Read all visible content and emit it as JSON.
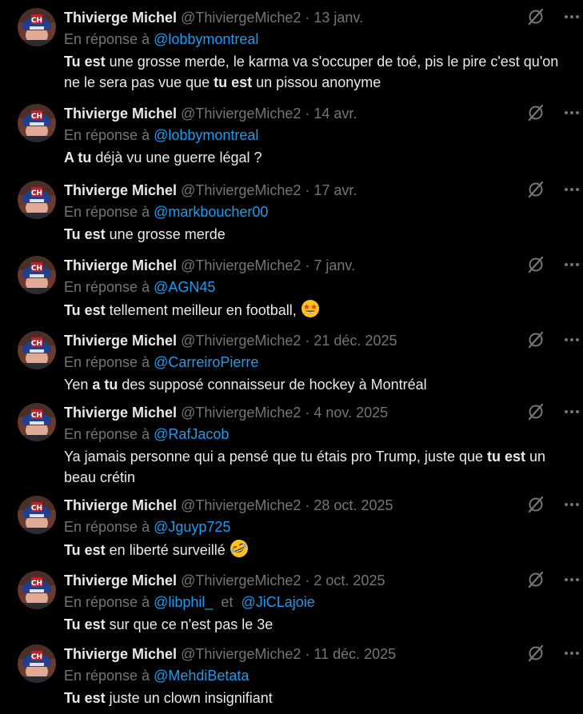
{
  "tweets": [
    {
      "name": "Thivierge Michel",
      "handle": "@ThiviergeMiche2",
      "date": "13 janv.",
      "reply_prefix": "En réponse à",
      "reply_to": [
        "@lobbymontreal"
      ],
      "segments": [
        {
          "t": "Tu est",
          "b": true
        },
        {
          "t": " une grosse merde, le karma va s'occuper de toé, pis le pire c'est qu'on ne le sera pas vue que ",
          "b": false
        },
        {
          "t": "tu est",
          "b": true
        },
        {
          "t": " un pissou anonyme",
          "b": false
        }
      ]
    },
    {
      "name": "Thivierge Michel",
      "handle": "@ThiviergeMiche2",
      "date": "14 avr.",
      "reply_prefix": "En réponse à",
      "reply_to": [
        "@lobbymontreal"
      ],
      "segments": [
        {
          "t": "A tu",
          "b": true
        },
        {
          "t": " déjà vu une guerre légal ?",
          "b": false
        }
      ]
    },
    {
      "name": "Thivierge Michel",
      "handle": "@ThiviergeMiche2",
      "date": "17 avr.",
      "reply_prefix": "En réponse à",
      "reply_to": [
        "@markboucher00"
      ],
      "segments": [
        {
          "t": "Tu est",
          "b": true
        },
        {
          "t": " une grosse merde",
          "b": false
        }
      ]
    },
    {
      "name": "Thivierge Michel",
      "handle": "@ThiviergeMiche2",
      "date": "7 janv.",
      "reply_prefix": "En réponse à",
      "reply_to": [
        "@AGN45"
      ],
      "segments": [
        {
          "t": "Tu est",
          "b": true
        },
        {
          "t": " tellement meilleur en football, ",
          "b": false
        }
      ],
      "emoji": "star-struck"
    },
    {
      "name": "Thivierge Michel",
      "handle": "@ThiviergeMiche2",
      "date": "21 déc. 2025",
      "reply_prefix": "En réponse à",
      "reply_to": [
        "@CarreiroPierre"
      ],
      "segments": [
        {
          "t": "Yen ",
          "b": false
        },
        {
          "t": "a tu",
          "b": true
        },
        {
          "t": " des supposé connaisseur de hockey à Montréal",
          "b": false
        }
      ]
    },
    {
      "name": "Thivierge Michel",
      "handle": "@ThiviergeMiche2",
      "date": "4 nov. 2025",
      "reply_prefix": "En réponse à",
      "reply_to": [
        "@RafJacob"
      ],
      "segments": [
        {
          "t": "Ya jamais personne qui a pensé que tu étais pro Trump, juste que ",
          "b": false
        },
        {
          "t": "tu est",
          "b": true
        },
        {
          "t": " un beau crétin",
          "b": false
        }
      ]
    },
    {
      "name": "Thivierge Michel",
      "handle": "@ThiviergeMiche2",
      "date": "28 oct. 2025",
      "reply_prefix": "En réponse à",
      "reply_to": [
        "@Jguyp725"
      ],
      "segments": [
        {
          "t": "Tu est",
          "b": true
        },
        {
          "t": " en liberté surveillé ",
          "b": false
        }
      ],
      "emoji": "rofl"
    },
    {
      "name": "Thivierge Michel",
      "handle": "@ThiviergeMiche2",
      "date": "2 oct. 2025",
      "reply_prefix": "En réponse à",
      "reply_to": [
        "@libphil_",
        "@JiCLajoie"
      ],
      "reply_joiner": "et",
      "segments": [
        {
          "t": "Tu est",
          "b": true
        },
        {
          "t": " sur que ce n'est pas le 3e",
          "b": false
        }
      ]
    },
    {
      "name": "Thivierge Michel",
      "handle": "@ThiviergeMiche2",
      "date": "11 déc. 2025",
      "reply_prefix": "En réponse à",
      "reply_to": [
        "@MehdiBetata"
      ],
      "segments": [
        {
          "t": "Tu est",
          "b": true
        },
        {
          "t": " juste un clown insignifiant",
          "b": false
        }
      ]
    }
  ],
  "icons": {
    "grok": "grok-icon",
    "more": "more-icon",
    "avatar": "avatar"
  },
  "colors": {
    "background": "#000000",
    "text": "#e7e9ea",
    "muted": "#71767b",
    "link": "#1d9bf0"
  },
  "separator": " · "
}
